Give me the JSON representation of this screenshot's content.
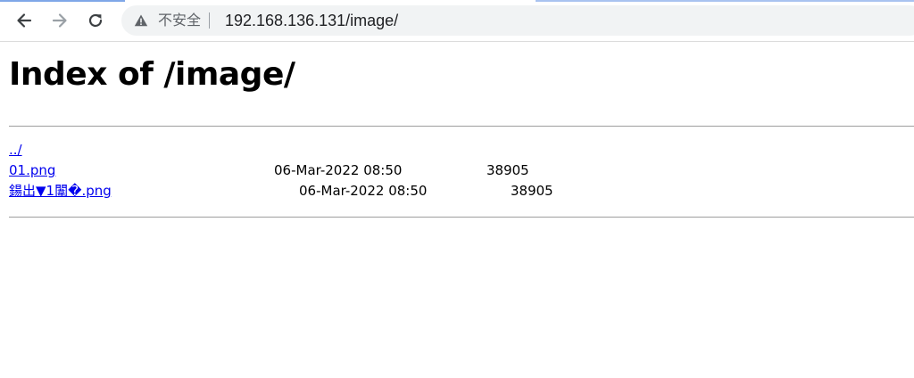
{
  "browser": {
    "icons": {
      "back": "arrow-left-icon",
      "forward": "arrow-right-icon",
      "reload": "reload-icon",
      "security": "warning-triangle-icon"
    },
    "security_label": "不安全",
    "url": "192.168.136.131/image/",
    "colors": {
      "omnibox_bg": "#f1f3f4",
      "icon": "#3c4043",
      "icon_disabled": "#9aa0a6"
    }
  },
  "page": {
    "title": "Index of /image/",
    "link_color": "#0000ee",
    "entries": [
      {
        "name": "../",
        "date": "",
        "size": ""
      },
      {
        "name": "01.png",
        "date": "06-Mar-2022 08:50",
        "size": "38905"
      },
      {
        "name": "鍚出▼1闈�.png",
        "date": "06-Mar-2022 08:50",
        "size": "38905"
      }
    ]
  }
}
